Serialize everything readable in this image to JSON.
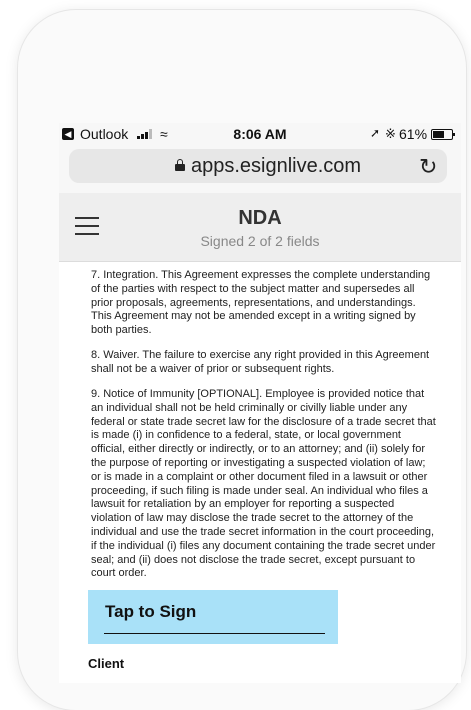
{
  "status_bar": {
    "back_icon": "back-arrow-icon",
    "carrier": "Outlook",
    "time": "8:06 AM",
    "battery_percent_label": "61%",
    "battery_level": 0.61
  },
  "url_bar": {
    "url": "apps.esignlive.com"
  },
  "document_header": {
    "title": "NDA",
    "subtitle": "Signed 2 of 2 fields"
  },
  "document": {
    "paragraphs": [
      "7.   Integration. This Agreement expresses the complete understanding of the parties with respect to the subject matter and supersedes all prior proposals, agreements, representations, and understandings. This Agreement may not be amended except in a writing signed by both parties.",
      "8.   Waiver. The failure to exercise any right provided in this Agreement shall not be a waiver of prior or subsequent rights.",
      "9.   Notice of Immunity [OPTIONAL]. Employee is provided notice that an individual shall not be held criminally or civilly liable under any federal or state trade secret law for the disclosure of a trade secret that is made (i) in confidence to a federal, state, or local government official, either directly or indirectly, or to an attorney; and (ii) solely for the purpose of reporting or investigating a suspected violation of law; or is made in a complaint or other document filed in a lawsuit or other proceeding, if such filing is made under seal. An individual who files a lawsuit for retaliation by an employer for reporting a suspected violation of law may disclose the trade secret to the attorney of the individual and use the trade secret information in the court proceeding, if the individual (i) files any document containing the trade secret under seal; and (ii) does not disclose the trade secret, except pursuant to court order."
    ],
    "sign_button_label": "Tap to Sign",
    "signer_label": "Client"
  },
  "colors": {
    "sign_box": "#a9e1f8",
    "header_bg": "#eeeeee"
  }
}
